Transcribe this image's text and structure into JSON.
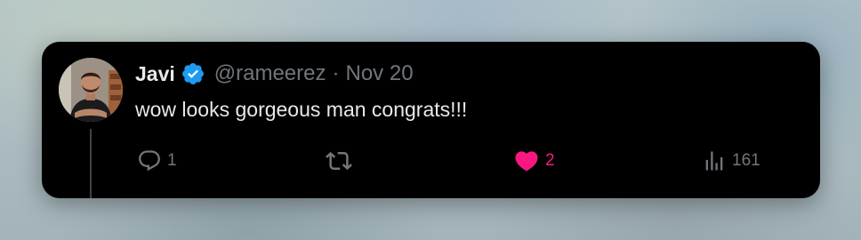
{
  "tweet": {
    "author_name": "Javi",
    "handle": "@rameerez",
    "separator": "·",
    "date": "Nov 20",
    "text": "wow looks gorgeous man congrats!!!",
    "verified": true
  },
  "actions": {
    "reply_count": "1",
    "retweet_count": "",
    "like_count": "2",
    "views_count": "161"
  },
  "colors": {
    "card_background": "#000000",
    "primary_text": "#e7e9ea",
    "secondary_text": "#71767b",
    "verified_badge": "#1d9bf0",
    "like_active": "#f91880",
    "thread_line": "#3f4449"
  },
  "icons": [
    "verified-badge-icon",
    "reply-icon",
    "retweet-icon",
    "heart-icon",
    "views-icon"
  ]
}
